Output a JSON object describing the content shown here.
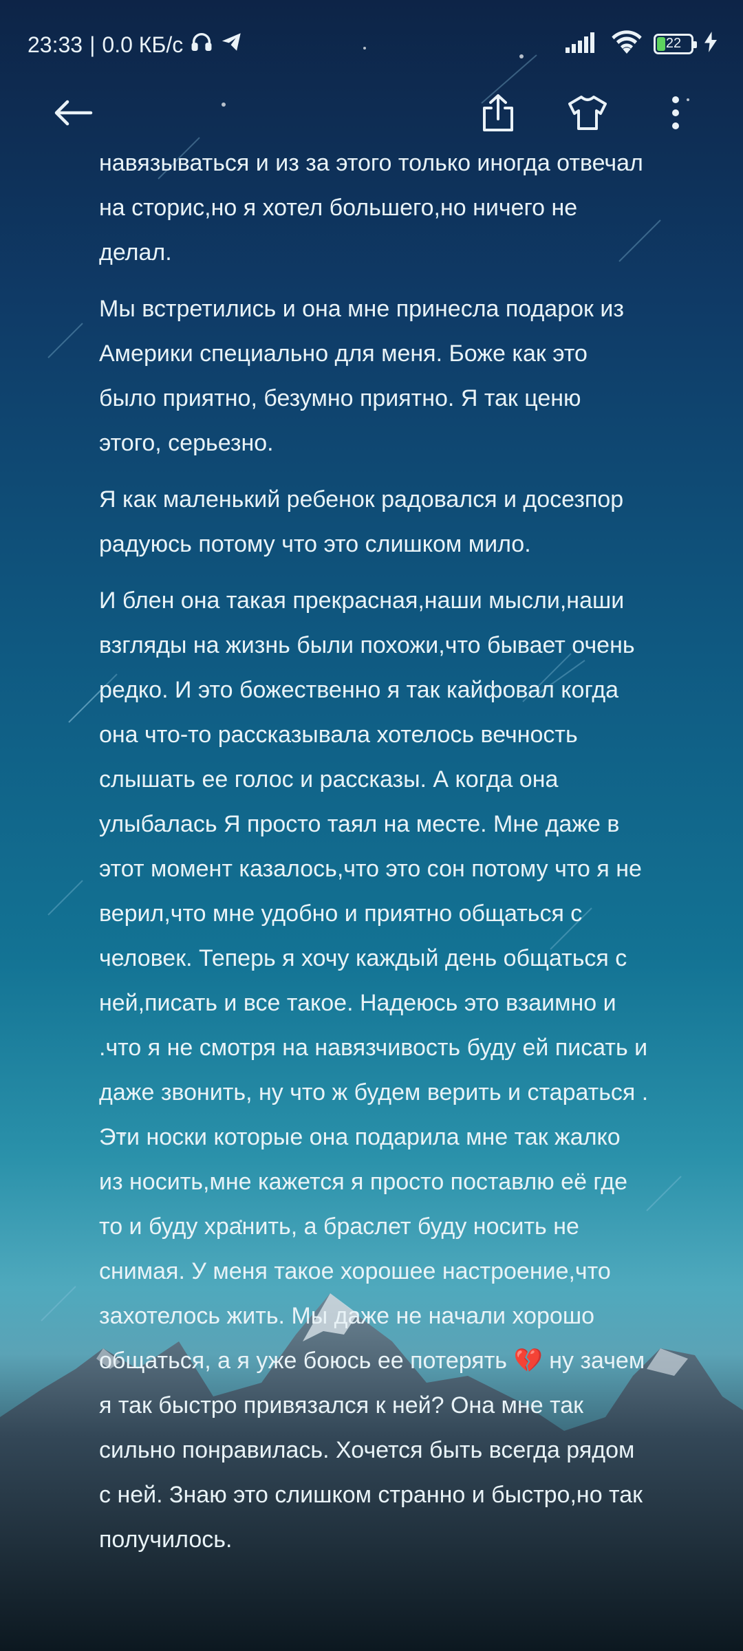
{
  "status_bar": {
    "time": "23:33",
    "network_speed": "0.0 КБ/с",
    "battery_level": "22",
    "icons": [
      "headphones-icon",
      "telegram-icon",
      "signal-icon",
      "wifi-icon",
      "battery-icon",
      "charging-icon"
    ]
  },
  "toolbar": {
    "icons": [
      "back-arrow-icon",
      "share-icon",
      "tshirt-theme-icon",
      "more-vertical-icon"
    ]
  },
  "story": {
    "paragraphs": [
      "навязываться и из за этого только иногда отвечал на сторис,но я хотел большего,но ничего не делал.",
      "Мы встретились и она мне принесла подарок из Америки специально для меня. Боже как это было приятно, безумно приятно. Я так ценю этого, серьезно.",
      "Я как маленький ребенок радовался и досезпор радуюсь потому что это слишком мило.",
      "И блен она такая прекрасная,наши мысли,наши взгляды на жизнь были похожи,что бывает очень редко. И это божественно я так кайфовал когда она что-то рассказывала хотелось вечность слышать ее голос и рассказы. А когда она улыбалась Я просто таял на месте. Мне даже в этот момент казалось,что это сон потому что я не верил,что мне удобно и приятно общаться с человек. Теперь я хочу каждый день общаться с ней,писать и все такое. Надеюсь это взаимно и .что я не смотря на навязчивость буду ей писать и даже звонить, ну что ж будем верить и стараться . Эти носки которые она подарила мне так жалко из носить,мне кажется я просто поставлю её где то и буду хранить, а браслет буду носить не снимая. У меня такое хорошее настроение,что захотелось жить. Мы даже не начали хорошо общаться, а я уже боюсь ее потерять 💔 ну зачем я так быстро привязался к ней? Она мне так сильно понравилась. Хочется быть всегда рядом с ней. Знаю это слишком странно и быстро,но так получилось."
    ]
  },
  "colors": {
    "sky_top": "#0d2447",
    "sky_mid": "#137394",
    "horizon": "#5ba3b6",
    "text": "#e9f3f7",
    "battery_fill": "#5ed35e"
  }
}
